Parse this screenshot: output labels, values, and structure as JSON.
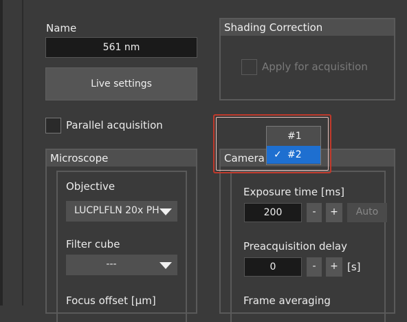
{
  "name_label": "Name",
  "name_value": "561 nm",
  "live_settings": "Live settings",
  "parallel_acquisition": "Parallel acquisition",
  "shading": {
    "title": "Shading Correction",
    "apply_label": "Apply for acquisition"
  },
  "microscope": {
    "title": "Microscope",
    "objective_label": "Objective",
    "objective_value": "LUCPLFLN 20x PH",
    "filter_cube_label": "Filter cube",
    "filter_cube_value": "---",
    "focus_offset_label": "Focus offset [µm]"
  },
  "camera": {
    "title": "Camera",
    "exposure_label": "Exposure time [ms]",
    "exposure_value": "200",
    "minus": "-",
    "plus": "+",
    "auto": "Auto",
    "preacq_label": "Preacquisition delay",
    "preacq_value": "0",
    "preacq_unit": "[s]",
    "frame_avg_label": "Frame averaging"
  },
  "camera_dropdown": {
    "options": [
      "#1",
      "#2"
    ],
    "selected": "#2",
    "check": "✓"
  },
  "colors": {
    "highlight_border": "#c0392b",
    "selected_option": "#1e6fd0"
  }
}
